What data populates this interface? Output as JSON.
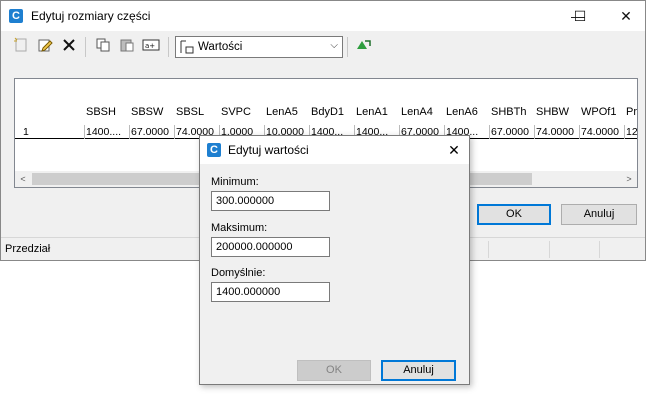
{
  "window": {
    "title": "Edytuj rozmiary części",
    "minimize_glyph": "—",
    "maximize_glyph": "☐",
    "close_glyph": "✕",
    "app_icon_letter": "C"
  },
  "toolbar": {
    "icons": [
      "new-row-icon",
      "edit-icon",
      "delete-icon",
      "copy-icon",
      "paste-icon",
      "rename-icon",
      "refresh-icon"
    ],
    "view_combo_value": "Wartości",
    "combo_arrow_glyph": "⌵"
  },
  "grid": {
    "columns": [
      "SBSH",
      "SBSW",
      "SBSL",
      "SVPC",
      "LenA5",
      "BdyD1",
      "LenA1",
      "LenA4",
      "LenA6",
      "SHBTh",
      "SHBW",
      "WPOf1",
      "Pr"
    ],
    "row_number": "1",
    "row_cells": [
      "1400....",
      "67.0000",
      "74.0000",
      "1.0000",
      "10.0000",
      "1400...",
      "1400...",
      "67.0000",
      "1400...",
      "67.0000",
      "74.0000",
      "74.0000",
      "12"
    ],
    "scroll_left_glyph": "<",
    "scroll_right_glyph": ">"
  },
  "main_buttons": {
    "ok": "OK",
    "cancel": "Anuluj"
  },
  "status": {
    "text": "Przedział"
  },
  "dialog": {
    "title": "Edytuj wartości",
    "close_glyph": "✕",
    "minimum_label": "Minimum:",
    "minimum_value": "300.000000",
    "maximum_label": "Maksimum:",
    "maximum_value": "200000.000000",
    "default_label": "Domyślnie:",
    "default_value": "1400.000000",
    "ok": "OK",
    "cancel": "Anuluj"
  }
}
